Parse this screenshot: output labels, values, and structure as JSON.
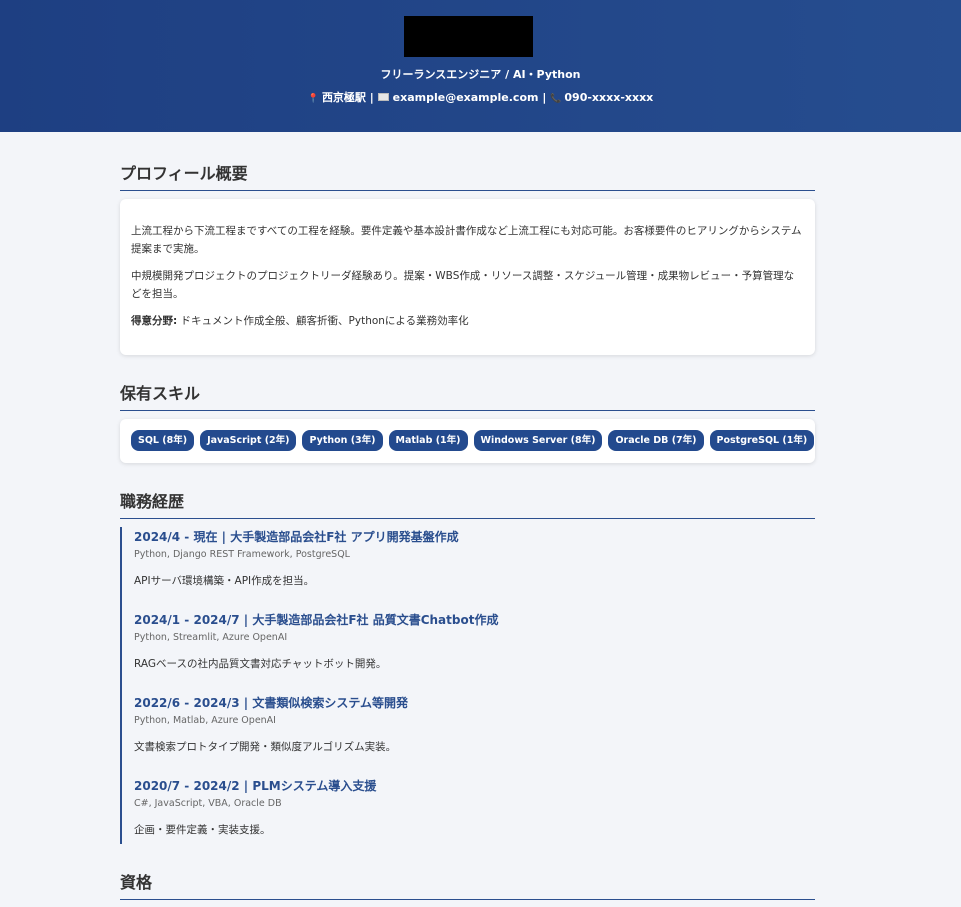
{
  "header": {
    "subtitle": "フリーランスエンジニア / AI・Python",
    "location": "西京極駅",
    "email": "example@example.com",
    "phone": "090-xxxx-xxxx",
    "sep": "|"
  },
  "profile": {
    "title": "プロフィール概要",
    "p1": "上流工程から下流工程まですべての工程を経験。要件定義や基本設計書作成など上流工程にも対応可能。お客様要件のヒアリングからシステム提案まで実施。",
    "p2": "中規模開発プロジェクトのプロジェクトリーダ経験あり。提案・WBS作成・リソース調整・スケジュール管理・成果物レビュー・予算管理などを担当。",
    "strength_label": "得意分野:",
    "strength_value": " ドキュメント作成全般、顧客折衝、Pythonによる業務効率化"
  },
  "skills": {
    "title": "保有スキル",
    "items": [
      "SQL (8年)",
      "JavaScript (2年)",
      "Python (3年)",
      "Matlab (1年)",
      "Windows Server (8年)",
      "Oracle DB (7年)",
      "PostgreSQL (1年)"
    ]
  },
  "career": {
    "title": "職務経歴",
    "jobs": [
      {
        "title": "2024/4 - 現在 | 大手製造部品会社F社 アプリ開発基盤作成",
        "tech": "Python, Django REST Framework, PostgreSQL",
        "desc": "APIサーバ環境構築・API作成を担当。"
      },
      {
        "title": "2024/1 - 2024/7 | 大手製造部品会社F社 品質文書Chatbot作成",
        "tech": "Python, Streamlit, Azure OpenAI",
        "desc": "RAGベースの社内品質文書対応チャットボット開発。"
      },
      {
        "title": "2022/6 - 2024/3 | 文書類似検索システム等開発",
        "tech": "Python, Matlab, Azure OpenAI",
        "desc": "文書検索プロトタイプ開発・類似度アルゴリズム実装。"
      },
      {
        "title": "2020/7 - 2024/2 | PLMシステム導入支援",
        "tech": "C#, JavaScript, VBA, Oracle DB",
        "desc": "企画・要件定義・実装支援。"
      }
    ]
  },
  "certs": {
    "title": "資格"
  },
  "icons": {
    "location": "pin-icon",
    "email": "mail-icon",
    "phone": "phone-icon"
  },
  "colors": {
    "header": "#1e3f82",
    "accent": "#234a8e",
    "pin": "#e8415f"
  }
}
